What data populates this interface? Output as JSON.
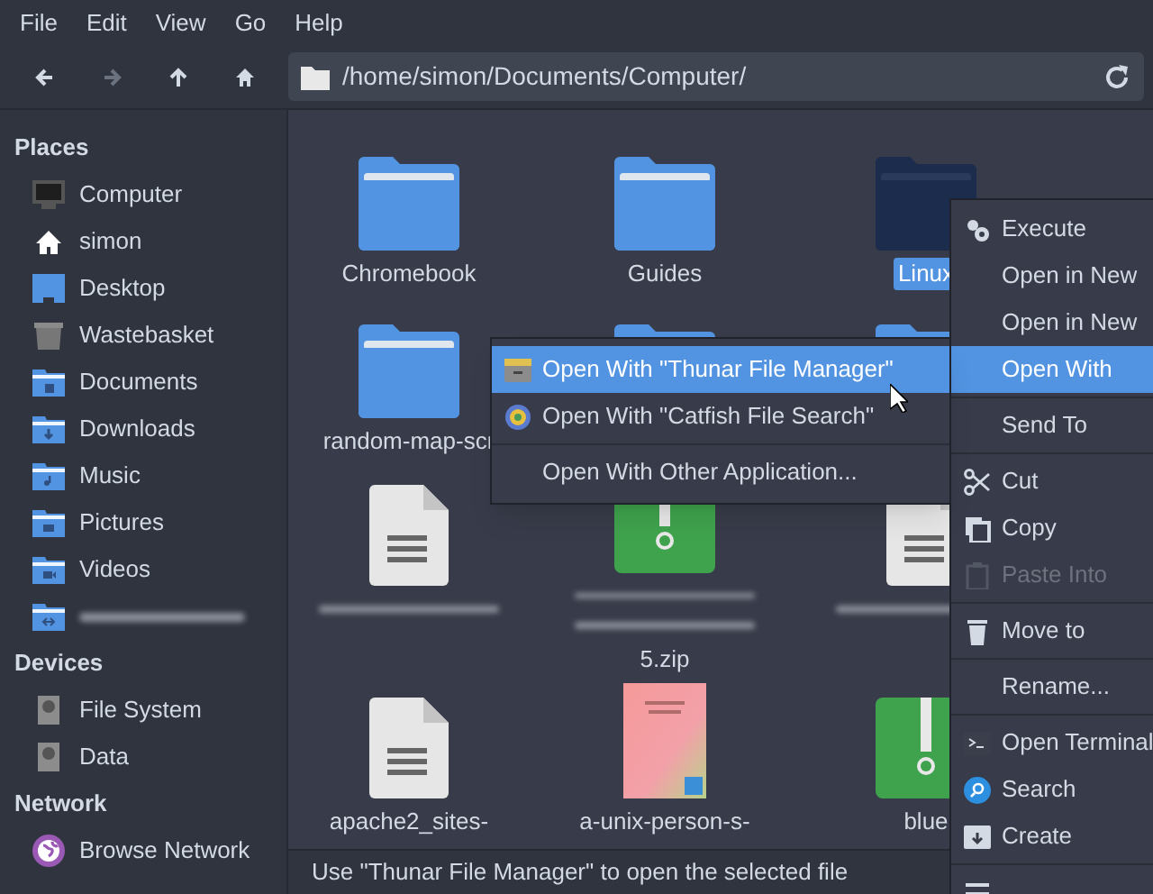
{
  "menubar": [
    "File",
    "Edit",
    "View",
    "Go",
    "Help"
  ],
  "toolbar": {
    "buttons": [
      {
        "kind": "back",
        "disabled": false
      },
      {
        "kind": "forward",
        "disabled": true
      },
      {
        "kind": "up",
        "disabled": false
      },
      {
        "kind": "home",
        "disabled": false
      }
    ],
    "path": "/home/simon/Documents/Computer/"
  },
  "sidebar": [
    {
      "title": "Places",
      "items": [
        {
          "label": "Computer",
          "kind": "computer"
        },
        {
          "label": "simon",
          "kind": "home"
        },
        {
          "label": "Desktop",
          "kind": "desktop"
        },
        {
          "label": "Wastebasket",
          "kind": "trash"
        },
        {
          "label": "Documents",
          "kind": "documents"
        },
        {
          "label": "Downloads",
          "kind": "downloads"
        },
        {
          "label": "Music",
          "kind": "music"
        },
        {
          "label": "Pictures",
          "kind": "pictures"
        },
        {
          "label": "Videos",
          "kind": "videos"
        },
        {
          "kind": "share",
          "redacted": true
        }
      ]
    },
    {
      "title": "Devices",
      "items": [
        {
          "label": "File System",
          "kind": "drive"
        },
        {
          "label": "Data",
          "kind": "drive"
        }
      ]
    },
    {
      "title": "Network",
      "items": [
        {
          "label": "Browse Network",
          "kind": "network"
        }
      ]
    }
  ],
  "files": [
    {
      "name": "Chromebook",
      "kind": "folder",
      "selected": false
    },
    {
      "name": "Guides",
      "kind": "folder",
      "selected": false
    },
    {
      "name": "Linux",
      "kind": "folder",
      "selected": true
    },
    {
      "name": "random-map-scr",
      "kind": "folder",
      "selected": false
    },
    {
      "kind": "folder",
      "selected": false
    },
    {
      "kind": "folder",
      "selected": false
    },
    {
      "kind": "text",
      "selected": false,
      "redacted": true
    },
    {
      "name": "5.zip",
      "kind": "zip",
      "selected": false,
      "redacted": true
    },
    {
      "kind": "text",
      "selected": false,
      "redacted": true
    },
    {
      "name": "apache2_sites-",
      "kind": "text",
      "selected": false
    },
    {
      "name": "a-unix-person-s-",
      "kind": "book",
      "selected": false
    },
    {
      "name": "blue",
      "kind": "zip",
      "selected": false
    }
  ],
  "context_menu": [
    {
      "label": "Execute",
      "kind": "gears",
      "selected": false,
      "disabled": false
    },
    {
      "label": "Open in New",
      "kind": "plain",
      "selected": false,
      "disabled": false
    },
    {
      "label": "Open in New",
      "kind": "plain",
      "selected": false,
      "disabled": false
    },
    {
      "label": "Open With",
      "kind": "plain",
      "selected": true,
      "disabled": false
    },
    {
      "kind": "separator"
    },
    {
      "label": "Send To",
      "kind": "plain",
      "selected": false,
      "disabled": false
    },
    {
      "kind": "separator"
    },
    {
      "label": "Cut",
      "kind": "scissors",
      "selected": false,
      "disabled": false
    },
    {
      "label": "Copy",
      "kind": "copy",
      "selected": false,
      "disabled": false
    },
    {
      "label": "Paste Into",
      "kind": "clipboard",
      "selected": false,
      "disabled": true
    },
    {
      "kind": "separator"
    },
    {
      "label": "Move to",
      "kind": "trash",
      "selected": false,
      "disabled": false
    },
    {
      "kind": "separator"
    },
    {
      "label": "Rename...",
      "kind": "plain",
      "selected": false,
      "disabled": false
    },
    {
      "kind": "separator"
    },
    {
      "label": "Open Terminal",
      "kind": "terminal",
      "selected": false,
      "disabled": false
    },
    {
      "label": "Search",
      "kind": "search",
      "selected": false,
      "disabled": false
    },
    {
      "label": "Create",
      "kind": "archive",
      "selected": false,
      "disabled": false
    },
    {
      "kind": "separator"
    },
    {
      "kind": "lines",
      "selected": false,
      "disabled": false
    }
  ],
  "submenu": [
    {
      "label": "Open With \"Thunar File Manager\"",
      "kind": "thunar",
      "selected": true
    },
    {
      "label": "Open With \"Catfish File Search\"",
      "kind": "catfish",
      "selected": false
    },
    {
      "kind": "separator"
    },
    {
      "label": "Open With Other Application...",
      "kind": "plain",
      "selected": false
    }
  ],
  "status_bar": "Use \"Thunar File Manager\" to open the selected file"
}
